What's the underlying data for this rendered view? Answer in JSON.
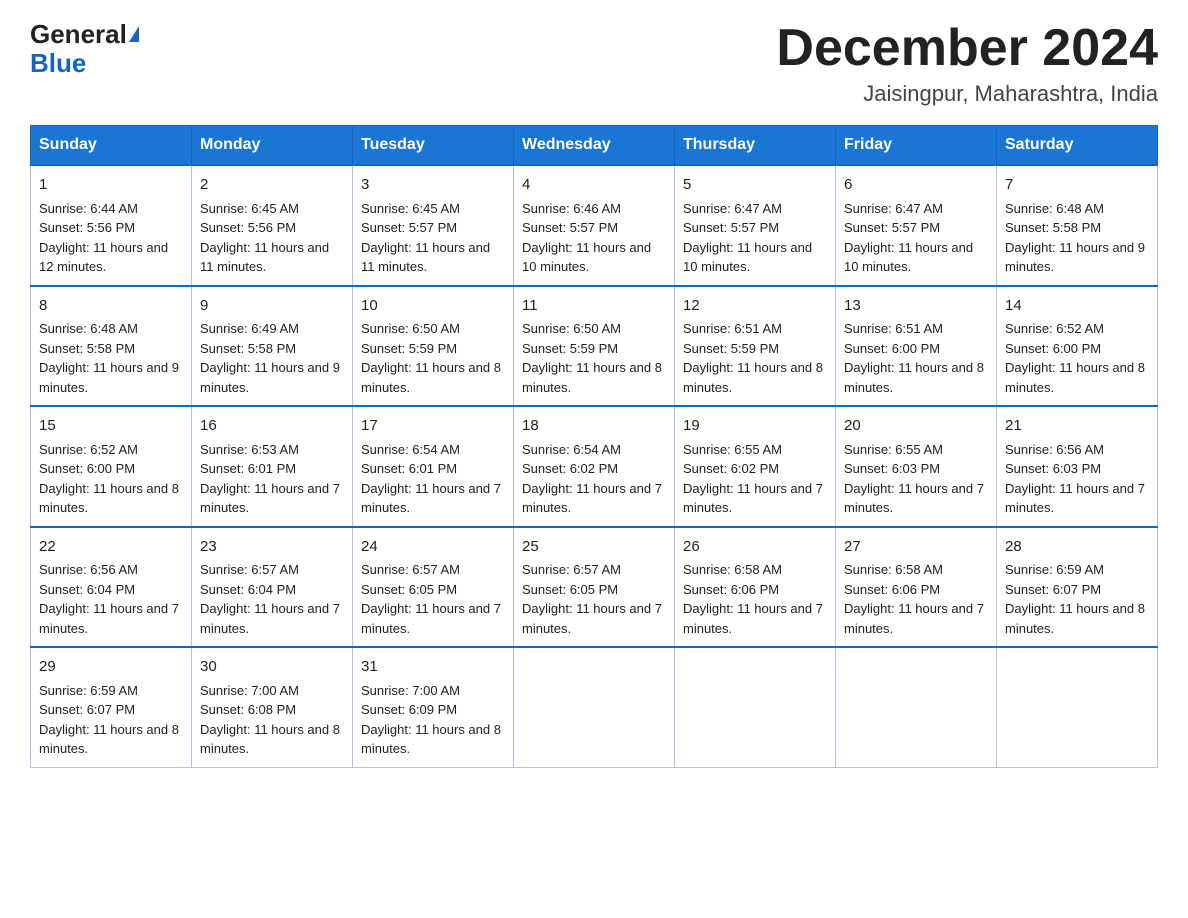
{
  "header": {
    "logo_general": "General",
    "logo_blue": "Blue",
    "month_title": "December 2024",
    "location": "Jaisingpur, Maharashtra, India"
  },
  "weekdays": [
    "Sunday",
    "Monday",
    "Tuesday",
    "Wednesday",
    "Thursday",
    "Friday",
    "Saturday"
  ],
  "weeks": [
    [
      {
        "day": "1",
        "sunrise": "6:44 AM",
        "sunset": "5:56 PM",
        "daylight": "11 hours and 12 minutes."
      },
      {
        "day": "2",
        "sunrise": "6:45 AM",
        "sunset": "5:56 PM",
        "daylight": "11 hours and 11 minutes."
      },
      {
        "day": "3",
        "sunrise": "6:45 AM",
        "sunset": "5:57 PM",
        "daylight": "11 hours and 11 minutes."
      },
      {
        "day": "4",
        "sunrise": "6:46 AM",
        "sunset": "5:57 PM",
        "daylight": "11 hours and 10 minutes."
      },
      {
        "day": "5",
        "sunrise": "6:47 AM",
        "sunset": "5:57 PM",
        "daylight": "11 hours and 10 minutes."
      },
      {
        "day": "6",
        "sunrise": "6:47 AM",
        "sunset": "5:57 PM",
        "daylight": "11 hours and 10 minutes."
      },
      {
        "day": "7",
        "sunrise": "6:48 AM",
        "sunset": "5:58 PM",
        "daylight": "11 hours and 9 minutes."
      }
    ],
    [
      {
        "day": "8",
        "sunrise": "6:48 AM",
        "sunset": "5:58 PM",
        "daylight": "11 hours and 9 minutes."
      },
      {
        "day": "9",
        "sunrise": "6:49 AM",
        "sunset": "5:58 PM",
        "daylight": "11 hours and 9 minutes."
      },
      {
        "day": "10",
        "sunrise": "6:50 AM",
        "sunset": "5:59 PM",
        "daylight": "11 hours and 8 minutes."
      },
      {
        "day": "11",
        "sunrise": "6:50 AM",
        "sunset": "5:59 PM",
        "daylight": "11 hours and 8 minutes."
      },
      {
        "day": "12",
        "sunrise": "6:51 AM",
        "sunset": "5:59 PM",
        "daylight": "11 hours and 8 minutes."
      },
      {
        "day": "13",
        "sunrise": "6:51 AM",
        "sunset": "6:00 PM",
        "daylight": "11 hours and 8 minutes."
      },
      {
        "day": "14",
        "sunrise": "6:52 AM",
        "sunset": "6:00 PM",
        "daylight": "11 hours and 8 minutes."
      }
    ],
    [
      {
        "day": "15",
        "sunrise": "6:52 AM",
        "sunset": "6:00 PM",
        "daylight": "11 hours and 8 minutes."
      },
      {
        "day": "16",
        "sunrise": "6:53 AM",
        "sunset": "6:01 PM",
        "daylight": "11 hours and 7 minutes."
      },
      {
        "day": "17",
        "sunrise": "6:54 AM",
        "sunset": "6:01 PM",
        "daylight": "11 hours and 7 minutes."
      },
      {
        "day": "18",
        "sunrise": "6:54 AM",
        "sunset": "6:02 PM",
        "daylight": "11 hours and 7 minutes."
      },
      {
        "day": "19",
        "sunrise": "6:55 AM",
        "sunset": "6:02 PM",
        "daylight": "11 hours and 7 minutes."
      },
      {
        "day": "20",
        "sunrise": "6:55 AM",
        "sunset": "6:03 PM",
        "daylight": "11 hours and 7 minutes."
      },
      {
        "day": "21",
        "sunrise": "6:56 AM",
        "sunset": "6:03 PM",
        "daylight": "11 hours and 7 minutes."
      }
    ],
    [
      {
        "day": "22",
        "sunrise": "6:56 AM",
        "sunset": "6:04 PM",
        "daylight": "11 hours and 7 minutes."
      },
      {
        "day": "23",
        "sunrise": "6:57 AM",
        "sunset": "6:04 PM",
        "daylight": "11 hours and 7 minutes."
      },
      {
        "day": "24",
        "sunrise": "6:57 AM",
        "sunset": "6:05 PM",
        "daylight": "11 hours and 7 minutes."
      },
      {
        "day": "25",
        "sunrise": "6:57 AM",
        "sunset": "6:05 PM",
        "daylight": "11 hours and 7 minutes."
      },
      {
        "day": "26",
        "sunrise": "6:58 AM",
        "sunset": "6:06 PM",
        "daylight": "11 hours and 7 minutes."
      },
      {
        "day": "27",
        "sunrise": "6:58 AM",
        "sunset": "6:06 PM",
        "daylight": "11 hours and 7 minutes."
      },
      {
        "day": "28",
        "sunrise": "6:59 AM",
        "sunset": "6:07 PM",
        "daylight": "11 hours and 8 minutes."
      }
    ],
    [
      {
        "day": "29",
        "sunrise": "6:59 AM",
        "sunset": "6:07 PM",
        "daylight": "11 hours and 8 minutes."
      },
      {
        "day": "30",
        "sunrise": "7:00 AM",
        "sunset": "6:08 PM",
        "daylight": "11 hours and 8 minutes."
      },
      {
        "day": "31",
        "sunrise": "7:00 AM",
        "sunset": "6:09 PM",
        "daylight": "11 hours and 8 minutes."
      },
      null,
      null,
      null,
      null
    ]
  ],
  "labels": {
    "sunrise": "Sunrise:",
    "sunset": "Sunset:",
    "daylight": "Daylight:"
  }
}
